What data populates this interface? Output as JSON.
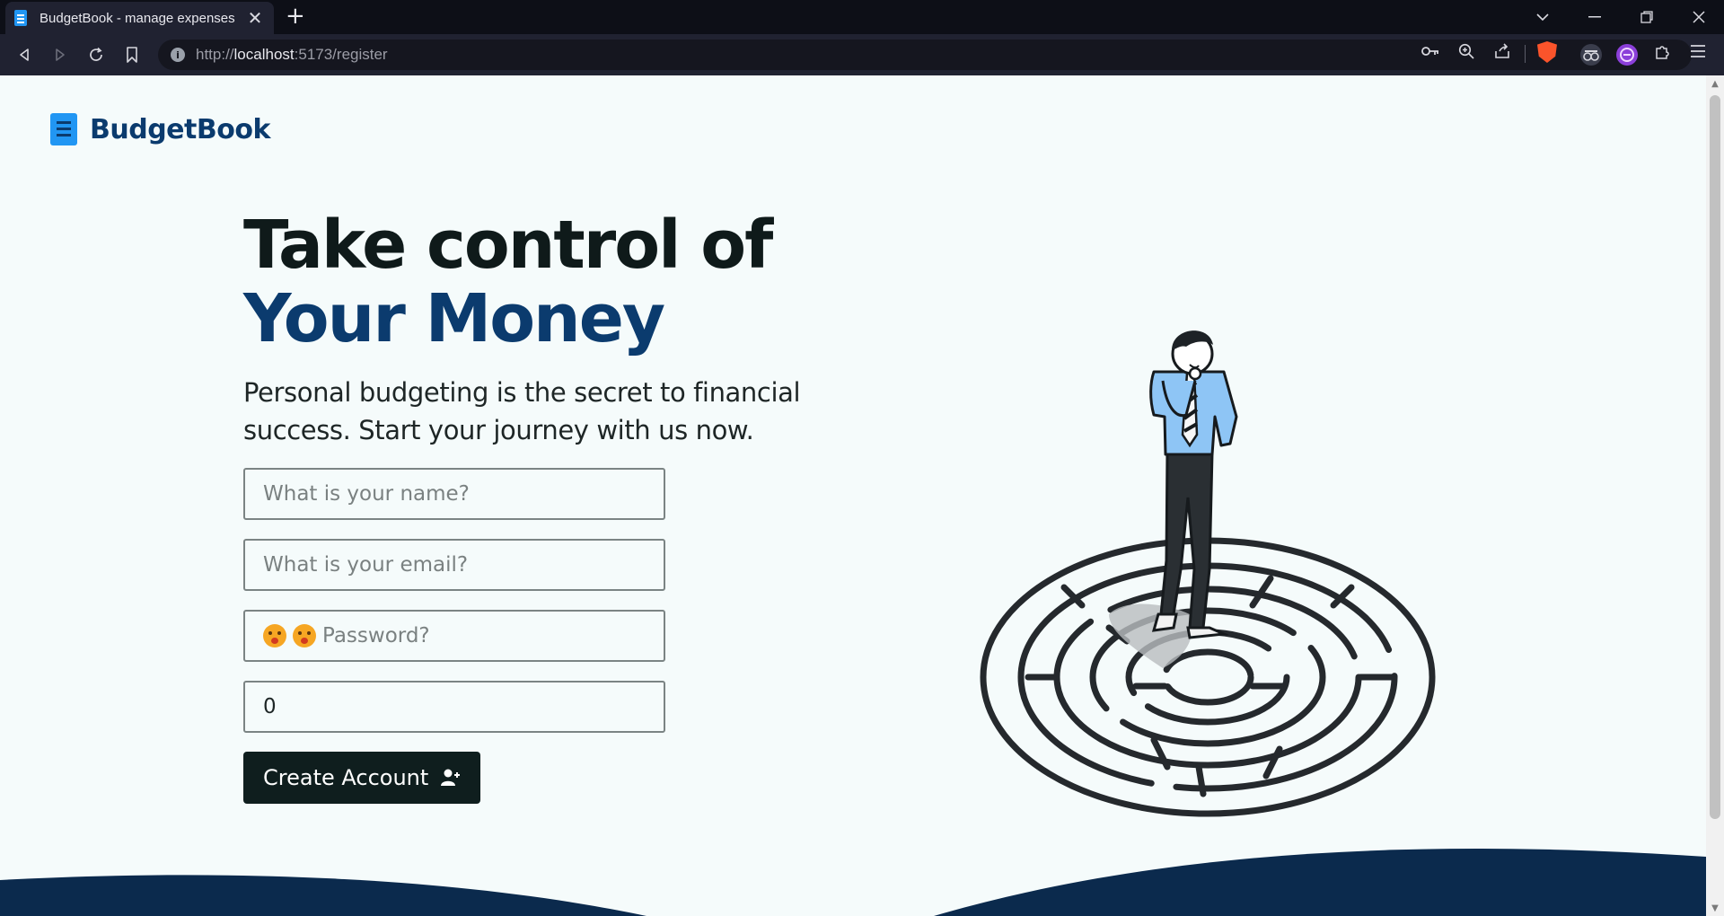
{
  "browser": {
    "tab_title": "BudgetBook - manage expenses",
    "tab_close": "✕",
    "new_tab": "+",
    "url_prefix": "http://",
    "url_host": "localhost",
    "url_rest": ":5173/register",
    "info_glyph": "i"
  },
  "brand": {
    "name": "BudgetBook",
    "color": "#0b3b6e",
    "accent": "#2196f3"
  },
  "hero": {
    "title_line1": "Take control of",
    "title_line2": "Your Money",
    "lead": "Personal budgeting is the secret to financial success. Start your journey with us now."
  },
  "form": {
    "name_placeholder": "What is your name?",
    "email_placeholder": "What is your email?",
    "password_placeholder": "Password?",
    "amount_value": "0",
    "submit_label": "Create Account"
  },
  "icons": [
    "receipt-icon",
    "user-plus-icon",
    "key-icon",
    "zoom-icon",
    "share-icon",
    "extensions-icon",
    "menu-icon"
  ]
}
